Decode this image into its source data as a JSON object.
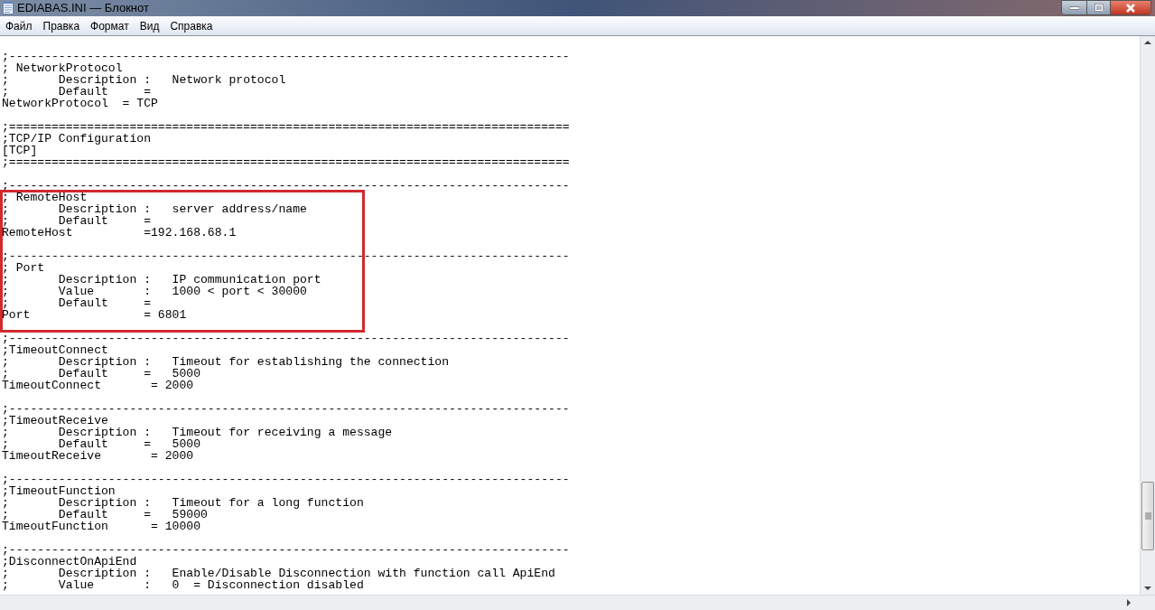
{
  "window": {
    "title": "EDIABAS.INI — Блокнот"
  },
  "menu": [
    "Файл",
    "Правка",
    "Формат",
    "Вид",
    "Справка"
  ],
  "editor": {
    "sections": [
      [
        ";-------------------------------------------------------------------------------",
        "; NetworkProtocol",
        ";       Description :   Network protocol",
        ";       Default     =",
        "NetworkProtocol  = TCP"
      ],
      [
        ";===============================================================================",
        ";TCP/IP Configuration",
        "[TCP]",
        ";==============================================================================="
      ],
      [
        ";-------------------------------------------------------------------------------",
        "; RemoteHost",
        ";       Description :   server address/name",
        ";       Default     =",
        "RemoteHost          =192.168.68.1"
      ],
      [
        ";-------------------------------------------------------------------------------",
        "; Port",
        ";       Description :   IP communication port",
        ";       Value       :   1000 < port < 30000",
        ";       Default     =",
        "Port                = 6801"
      ],
      [
        ";-------------------------------------------------------------------------------",
        ";TimeoutConnect",
        ";       Description :   Timeout for establishing the connection",
        ";       Default     =   5000",
        "TimeoutConnect       = 2000"
      ],
      [
        ";-------------------------------------------------------------------------------",
        ";TimeoutReceive",
        ";       Description :   Timeout for receiving a message",
        ";       Default     =   5000",
        "TimeoutReceive       = 2000"
      ],
      [
        ";-------------------------------------------------------------------------------",
        ";TimeoutFunction",
        ";       Description :   Timeout for a long function",
        ";       Default     =   59000",
        "TimeoutFunction      = 10000"
      ],
      [
        ";-------------------------------------------------------------------------------",
        ";DisconnectOnApiEnd",
        ";       Description :   Enable/Disable Disconnection with function call ApiEnd",
        ";       Value       :   0  = Disconnection disabled"
      ]
    ]
  }
}
